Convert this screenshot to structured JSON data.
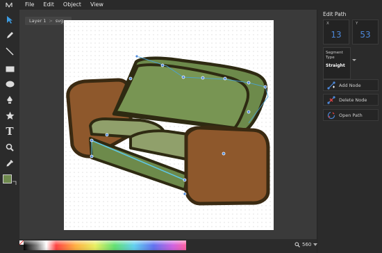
{
  "menu": [
    "File",
    "Edit",
    "Object",
    "View"
  ],
  "layer_tab": {
    "layer": "Layer 1",
    "element": "svg..."
  },
  "colors": {
    "fill_swatch": "#6f8a4e",
    "stroke_swatch": "#ffffff",
    "node_accent": "#4d88d9",
    "couch_back": "#738f51",
    "couch_seat": "#90a06b",
    "couch_arm": "#8e582c",
    "couch_outline": "#3a2a12"
  },
  "panel": {
    "title": "Edit Path",
    "x_label": "X",
    "x_value": "13",
    "y_label": "Y",
    "y_value": "53",
    "segment_type_label": "Segment Type",
    "segment_type_value": "Straight",
    "buttons": [
      "Add Node",
      "Delete Node",
      "Open Path"
    ]
  },
  "zoom": {
    "value": "560"
  },
  "tools": [
    "select-icon",
    "pencil-icon",
    "line-icon",
    "rectangle-icon",
    "ellipse-icon",
    "pen-icon",
    "star-icon",
    "text-icon",
    "zoom-icon",
    "eyedropper-icon"
  ]
}
